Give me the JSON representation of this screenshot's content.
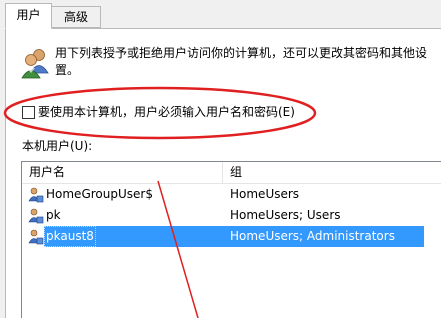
{
  "tabs": [
    {
      "label": "用户",
      "active": true
    },
    {
      "label": "高级",
      "active": false
    }
  ],
  "intro_text": "用下列表授予或拒绝用户访问你的计算机，还可以更改其密码和其他设置。",
  "require_login_checkbox": {
    "label": "要使用本计算机，用户必须输入用户名和密码(E)",
    "checked": false
  },
  "users_list_label": "本机用户(U):",
  "columns": [
    "用户名",
    "组"
  ],
  "rows": [
    {
      "name": "HomeGroupUser$",
      "group": "HomeUsers",
      "selected": false,
      "icon": "user-icon"
    },
    {
      "name": "pk",
      "group": "HomeUsers; Users",
      "selected": false,
      "icon": "user-icon"
    },
    {
      "name": "pkaust8",
      "group": "HomeUsers; Administrators",
      "selected": true,
      "icon": "user-icon"
    }
  ],
  "colors": {
    "selection": "#3399ff",
    "annotation_red": "#e02020",
    "panel": "#ffffff",
    "window": "#f0f0f0"
  },
  "header_icon": "users-icon"
}
